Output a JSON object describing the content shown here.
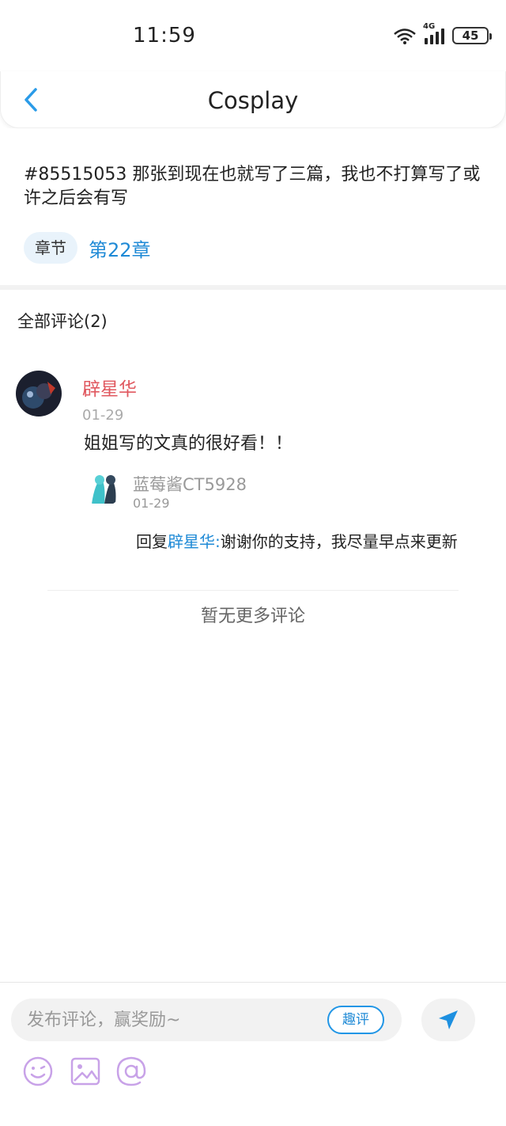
{
  "status_bar": {
    "time": "11:59",
    "network": "4G",
    "battery": "45"
  },
  "header": {
    "title": "Cosplay",
    "back_icon": "chevron-left-icon"
  },
  "post": {
    "text": "#85515053 那张到现在也就写了三篇，我也不打算写了或许之后会有写",
    "tag_label": "章节",
    "chapter_link": "第22章"
  },
  "comments": {
    "header": "全部评论(2)",
    "items": [
      {
        "user": "辟星华",
        "date": "01-29",
        "text": "姐姐写的文真的很好看！！",
        "reply": {
          "user": "蓝莓酱CT5928",
          "date": "01-29",
          "prefix": "回复",
          "mention": "辟星华",
          "separator": ":",
          "text": "谢谢你的支持，我尽量早点来更新"
        }
      }
    ],
    "no_more": "暂无更多评论"
  },
  "bottom_bar": {
    "placeholder": "发布评论，赢奖励~",
    "qu_ping_label": "趣评",
    "send_icon": "send-icon",
    "tools": [
      "emoji-icon",
      "image-icon",
      "at-icon"
    ]
  },
  "colors": {
    "accent": "#1f8ad6",
    "username": "#e0585f",
    "tool_purple": "#c8a2e8"
  }
}
